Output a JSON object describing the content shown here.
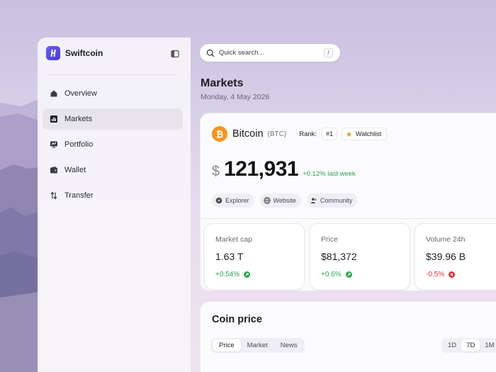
{
  "brand": {
    "name": "Swiftcoin"
  },
  "sidebar": {
    "items": [
      {
        "label": "Overview",
        "icon": "home-icon",
        "active": false
      },
      {
        "label": "Markets",
        "icon": "chart-icon",
        "active": true
      },
      {
        "label": "Portfolio",
        "icon": "presentation-icon",
        "active": false
      },
      {
        "label": "Wallet",
        "icon": "wallet-icon",
        "active": false
      },
      {
        "label": "Transfer",
        "icon": "transfer-icon",
        "active": false
      }
    ]
  },
  "search": {
    "placeholder": "Quick search...",
    "shortcut": "/"
  },
  "page": {
    "title": "Markets",
    "date": "Monday, 4 May 2026"
  },
  "coin": {
    "logo_glyph": "₿",
    "name": "Bitcoin",
    "ticker": "(BTC)",
    "rank_label": "Rank:",
    "rank_value": "#1",
    "watchlist_label": "Watchlist",
    "currency": "$",
    "price": "121,931",
    "change": "+0.12% last week",
    "links": [
      {
        "label": "Explorer",
        "icon": "compass-icon"
      },
      {
        "label": "Website",
        "icon": "globe-icon"
      },
      {
        "label": "Community",
        "icon": "users-icon"
      }
    ]
  },
  "stats": [
    {
      "label": "Market cap",
      "value": "1.63 T",
      "change": "+0.54%",
      "direction": "up"
    },
    {
      "label": "Price",
      "value": "$81,372",
      "change": "+0.6%",
      "direction": "up"
    },
    {
      "label": "Volume 24h",
      "value": "$39.96 B",
      "change": "-0.5%",
      "direction": "down"
    }
  ],
  "coin_price": {
    "title": "Coin price",
    "tabs": [
      "Price",
      "Market",
      "News"
    ],
    "ranges": [
      "1D",
      "7D",
      "1M"
    ]
  },
  "colors": {
    "accent": "#5b4be8",
    "bitcoin": "#f7931a",
    "positive": "#2aa84a",
    "negative": "#e0343c"
  }
}
